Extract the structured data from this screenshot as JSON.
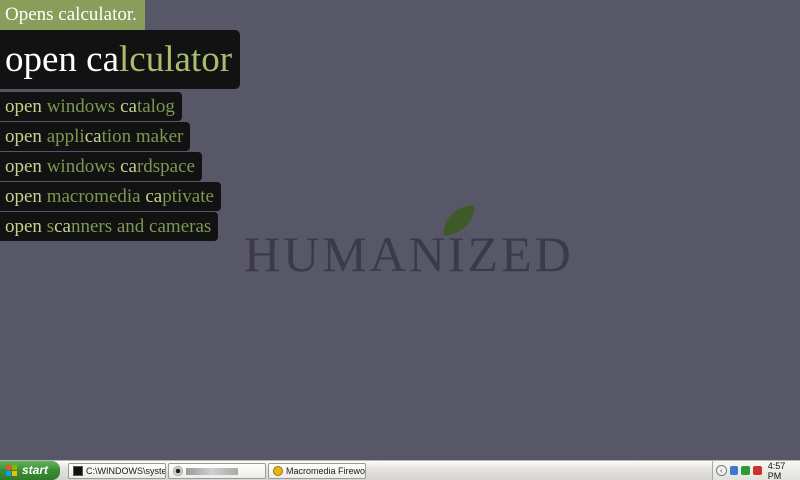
{
  "overlay": {
    "hint": "Opens calculator.",
    "main": {
      "typed": "open ca",
      "rest": "lculator"
    },
    "suggestions": [
      {
        "typed": "open ",
        "rest": "windows ",
        "typed2": "ca",
        "rest2": "talog"
      },
      {
        "typed": "open ",
        "rest": "appli",
        "typed2": "ca",
        "rest2": "tion maker"
      },
      {
        "typed": "open ",
        "rest": "windows ",
        "typed2": "ca",
        "rest2": "rdspace"
      },
      {
        "typed": "open ",
        "rest": "macromedia ",
        "typed2": "ca",
        "rest2": "ptivate"
      },
      {
        "typed": "open ",
        "rest": "s",
        "typed2": "ca",
        "rest2": "nners and cameras"
      }
    ]
  },
  "logo": {
    "text": "HUMANIZED"
  },
  "taskbar": {
    "start_label": "start",
    "tasks": [
      {
        "label": "C:\\WINDOWS\\syste...",
        "icon": "cmd-icon"
      },
      {
        "label": "",
        "icon": "eye-icon"
      },
      {
        "label": "Macromedia Firework...",
        "icon": "fireworks-icon"
      }
    ],
    "clock": "4:57 PM"
  },
  "colors": {
    "desktop": "#585768",
    "hint_bg": "#8a9d5a",
    "suggestion_bg": "#121212",
    "typed_text": "#c2d48c",
    "completion_text": "#7e9752",
    "logo_text": "#3a3a4c",
    "leaf": "#3e5a28"
  }
}
